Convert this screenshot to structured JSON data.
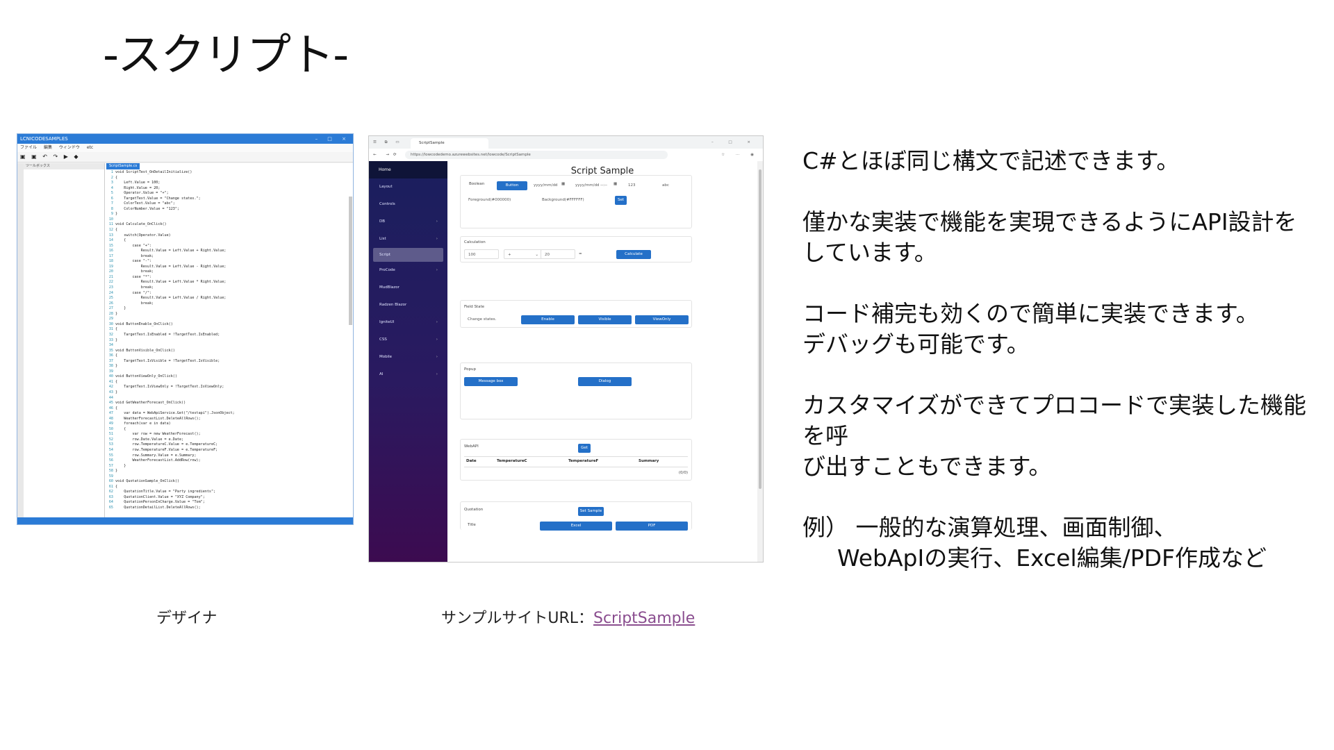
{
  "slide": {
    "title": "-スクリプト-",
    "bullets": [
      "C#とほぼ同じ構文で記述できます。",
      "僅かな実装で機能を実現できるようにAPI設計を",
      "しています。",
      "コード補完も効くので簡単に実装できます。",
      "デバッグも可能です。",
      "カスタマイズができてプロコードで実装した機能を呼",
      "び出すこともできます。",
      "例） 一般的な演算処理、画面制御、",
      "WebApIの実行、Excel編集/PDF作成など"
    ],
    "caption_left": "デザイナ",
    "caption_right_prefix": "サンプルサイトURL：",
    "caption_right_link": "ScriptSample"
  },
  "designer": {
    "title": "LCNICODESAMPLES",
    "menu": [
      "ファイル",
      "編集",
      "ウィンドウ",
      "etc"
    ],
    "pane_title": "ツールボックス",
    "tab": "ScriptSample.cs",
    "code": [
      "void ScriptTest_OnDetailInitialize()",
      "{",
      "    Left.Value = 100;",
      "    Right.Value = 20;",
      "    Operator.Value = \"+\";",
      "    TargetText.Value = \"Change states.\";",
      "    ColorText.Value = \"abc\";",
      "    ColorNumber.Value = \"123\";",
      "}",
      "",
      "void Calculate_OnClick()",
      "{",
      "    switch(Operator.Value)",
      "    {",
      "        case \"+\":",
      "            Result.Value = Left.Value + Right.Value;",
      "            break;",
      "        case \"-\":",
      "            Result.Value = Left.Value - Right.Value;",
      "            break;",
      "        case \"*\":",
      "            Result.Value = Left.Value * Right.Value;",
      "            break;",
      "        case \"/\":",
      "            Result.Value = Left.Value / Right.Value;",
      "            break;",
      "    }",
      "}",
      "",
      "void ButtonEnable_OnClick()",
      "{",
      "    TargetText.IsEnabled = !TargetText.IsEnabled;",
      "}",
      "",
      "void ButtonVisible_OnClick()",
      "{",
      "    TargetText.IsVisible = !TargetText.IsVisible;",
      "}",
      "",
      "void ButtonViewOnly_OnClick()",
      "{",
      "    TargetText.IsViewOnly = !TargetText.IsViewOnly;",
      "}",
      "",
      "void GetWeatherForecast_OnClick()",
      "{",
      "    var data = WebApiService.Get(\"/testapi\").JsonObject;",
      "    WeatherForecastList.DeleteAllRows();",
      "    foreach(var e in data)",
      "    {",
      "        var row = new WeatherForecast();",
      "        row.Date.Value = e.Date;",
      "        row.TemperatureC.Value = e.TemperatureC;",
      "        row.TemperatureF.Value = e.TemperatureF;",
      "        row.Summary.Value = e.Summary;",
      "        WeatherForecastList.AddRow(row);",
      "    }",
      "}",
      "",
      "void QuotationSample_OnClick()",
      "{",
      "    QuotationTitle.Value = \"Party ingredients\";",
      "    QuotationClient.Value = \"XYZ Company\";",
      "    QuotationPersonInCharge.Value = \"Tom\";",
      "    QuotationDetailList.DeleteAllRows();"
    ]
  },
  "browser": {
    "tab_title": "ScriptSample",
    "url": "https://lowcodedemo.azurewebsites.net/lowcode/ScriptSample",
    "sidebar": {
      "home": "Home",
      "items": [
        {
          "label": "Layout",
          "chevron": false
        },
        {
          "label": "Controls",
          "chevron": false
        },
        {
          "label": "DB",
          "chevron": true
        },
        {
          "label": "List",
          "chevron": true
        },
        {
          "label": "Script",
          "chevron": false,
          "active": true
        },
        {
          "label": "ProCode",
          "chevron": true
        },
        {
          "label": "MudBlazor",
          "chevron": false
        },
        {
          "label": "Radzen Blazor",
          "chevron": false
        },
        {
          "label": "IgniteUI",
          "chevron": true
        },
        {
          "label": "CSS",
          "chevron": true
        },
        {
          "label": "Mobile",
          "chevron": true
        },
        {
          "label": "AI",
          "chevron": true
        }
      ]
    },
    "page_title": "Script Sample",
    "boolean_card": {
      "label": "Boolean",
      "button": "Button",
      "date1": "yyyy/mm/dd",
      "date2": "yyyy/mm/dd --:--",
      "number": "123",
      "text": "abc",
      "foreground": "Foreground(#000000)",
      "background": "Background(#FFFFFF)",
      "set": "Set"
    },
    "calc_card": {
      "label": "Calculation",
      "left": "100",
      "operator": "+",
      "right": "20",
      "equals": "=",
      "button": "Calculate"
    },
    "field_card": {
      "label": "Field State",
      "value": "Change states.",
      "buttons": [
        "Enable",
        "Visible",
        "ViewOnly"
      ]
    },
    "popup_card": {
      "label": "Popup",
      "buttons": [
        "Message box",
        "Dialog"
      ]
    },
    "webapi_card": {
      "label": "WebAPI",
      "get": "Get",
      "columns": [
        "Date",
        "TemperatureC",
        "TemperatureF",
        "Summary"
      ],
      "footer": "(0/0)"
    },
    "quote_card": {
      "label": "Quotation",
      "set_sample": "Set Sample",
      "title_label": "Title",
      "buttons": [
        "Excel",
        "PDF"
      ]
    }
  }
}
